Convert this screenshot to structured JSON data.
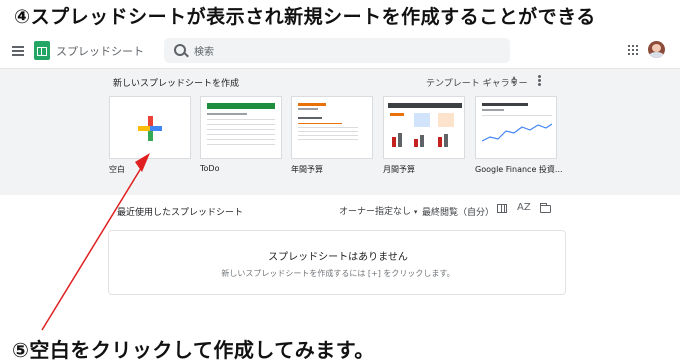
{
  "captions": {
    "top": "④スプレッドシートが表示され新規シートを作成することができる",
    "bottom": "⑤空白をクリックして作成してみます。"
  },
  "header": {
    "app_name": "スプレッドシート",
    "search_placeholder": "検索",
    "icons": [
      "menu-icon",
      "sheets-logo-icon",
      "search-icon",
      "apps-grid-icon",
      "account-avatar"
    ]
  },
  "templates": {
    "section_title": "新しいスプレッドシートを作成",
    "gallery_label": "テンプレート ギャラリー",
    "items": [
      {
        "label": "空白"
      },
      {
        "label": "ToDo"
      },
      {
        "label": "年間予算"
      },
      {
        "label": "月間予算"
      },
      {
        "label": "Google Finance 投資..."
      }
    ]
  },
  "recent": {
    "title": "最近使用したスプレッドシート",
    "owner_filter": "オーナー指定なし",
    "sort_label": "最終閲覧（自分）",
    "sort_icon_text": "AZ"
  },
  "empty_state": {
    "title": "スプレッドシートはありません",
    "subtitle": "新しいスプレッドシートを作成するには [+] をクリックします。"
  },
  "colors": {
    "annotation_arrow": "#e02020",
    "sheets_green": "#23a566",
    "band_bg": "#f1f3f4"
  }
}
